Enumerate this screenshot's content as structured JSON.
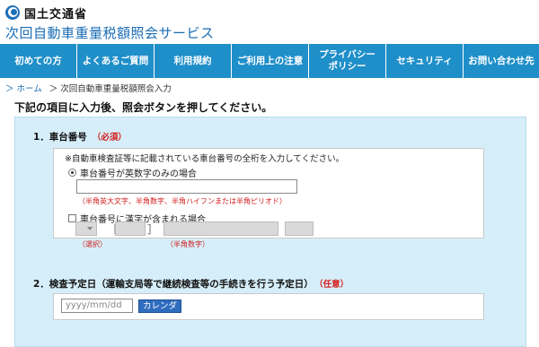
{
  "header": {
    "ministry": "国土交通省",
    "service_title": "次回自動車重量税額照会サービス"
  },
  "nav": {
    "items": [
      {
        "label": "初めての方"
      },
      {
        "label": "よくあるご質問"
      },
      {
        "label": "利用規約"
      },
      {
        "label": "ご利用上の注意"
      },
      {
        "label": "プライバシー\nポリシー"
      },
      {
        "label": "セキュリティ"
      },
      {
        "label": "お問い合わせ先"
      }
    ]
  },
  "breadcrumb": {
    "home": "＞ ホーム",
    "current": "＞ 次回自動車重量税額照会入力"
  },
  "instruction": "下記の項目に入力後、照会ボタンを押してください。",
  "section1": {
    "label": "1．車台番号",
    "required": "（必須）",
    "note": "※自動車検査証等に記載されている車台番号の全桁を入力してください。",
    "option_alnum": "車台番号が英数字のみの場合",
    "option_alnum_hint": "（半角英大文字、半角数字、半角ハイフンまたは半角ピリオド）",
    "option_kanji": "車台番号に漢字が含まれる場合",
    "select_hint": "（選択）",
    "number_hint": "（半角数字）",
    "bracket_open": "［",
    "bracket_close": "］"
  },
  "section2": {
    "label": "2．検査予定日（運輸支局等で継続検査等の手続きを行う予定日）",
    "optional": "（任意）",
    "date_placeholder": "yyyy/mm/dd",
    "calendar_button": "カレンダー"
  },
  "colors": {
    "nav_bg": "#1f8fc9",
    "panel_bg": "#d6eef9",
    "accent": "#1a6cb5",
    "required_red": "#d21e1e",
    "button_blue": "#2f6dbf"
  }
}
